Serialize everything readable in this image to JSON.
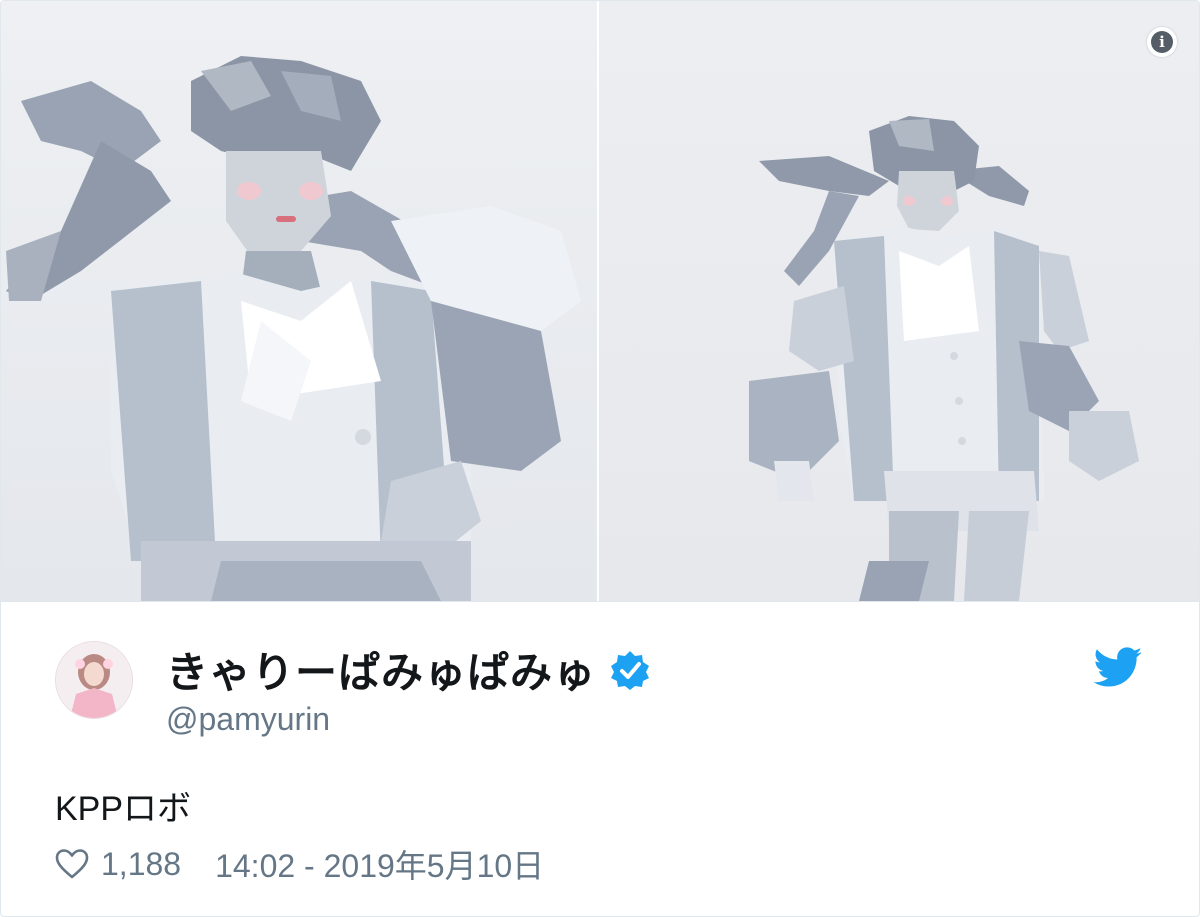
{
  "media": {
    "info_icon": "info-icon",
    "info_glyph": "i"
  },
  "user": {
    "display_name": "きゃりーぱみゅぱみゅ",
    "handle": "@pamyurin",
    "verified_icon": "verified-badge-icon",
    "avatar_icon": "avatar"
  },
  "tweet": {
    "text": "KPPロボ",
    "likes": "1,188",
    "timestamp": "14:02 - 2019年5月10日"
  },
  "icons": {
    "brand": "twitter-bird-icon",
    "like": "heart-icon"
  },
  "colors": {
    "brand": "#1da1f2",
    "muted": "#657786",
    "text": "#14171a"
  }
}
